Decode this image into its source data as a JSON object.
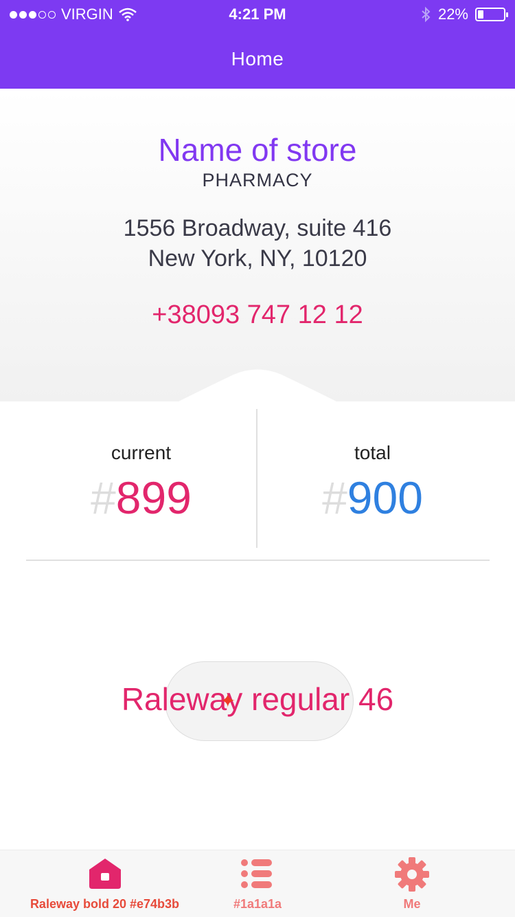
{
  "status_bar": {
    "carrier": "VIRGIN",
    "time": "4:21 PM",
    "battery_text": "22%",
    "battery_level": 0.22,
    "icons": [
      "signal-dots-icon",
      "wifi-icon",
      "bluetooth-icon",
      "battery-icon"
    ]
  },
  "nav": {
    "title": "Home"
  },
  "store": {
    "name": "Name of store",
    "type": "PHARMACY",
    "address_line1": "1556 Broadway, suite 416",
    "address_line2": "New York, NY, 10120",
    "phone": "+38093 747 12 12"
  },
  "counters": {
    "current": {
      "label": "current",
      "hash": "#",
      "value": "899"
    },
    "total": {
      "label": "total",
      "hash": "#",
      "value": "900"
    }
  },
  "center_text": "Raleway regular 46",
  "tabs": [
    {
      "label": "Raleway bold 20 #e74b3b",
      "icon": "home-icon",
      "active": true
    },
    {
      "label": "#1a1a1a",
      "icon": "list-icon",
      "active": false
    },
    {
      "label": "Me",
      "icon": "gear-icon",
      "active": false
    }
  ],
  "colors": {
    "header_purple": "#7d3af2",
    "store_name": "#8138f1",
    "accent_pink": "#e2266c",
    "total_blue": "#2f80e0",
    "tab_active": "#e74b3b",
    "tab_inactive": "#f07a7a"
  }
}
